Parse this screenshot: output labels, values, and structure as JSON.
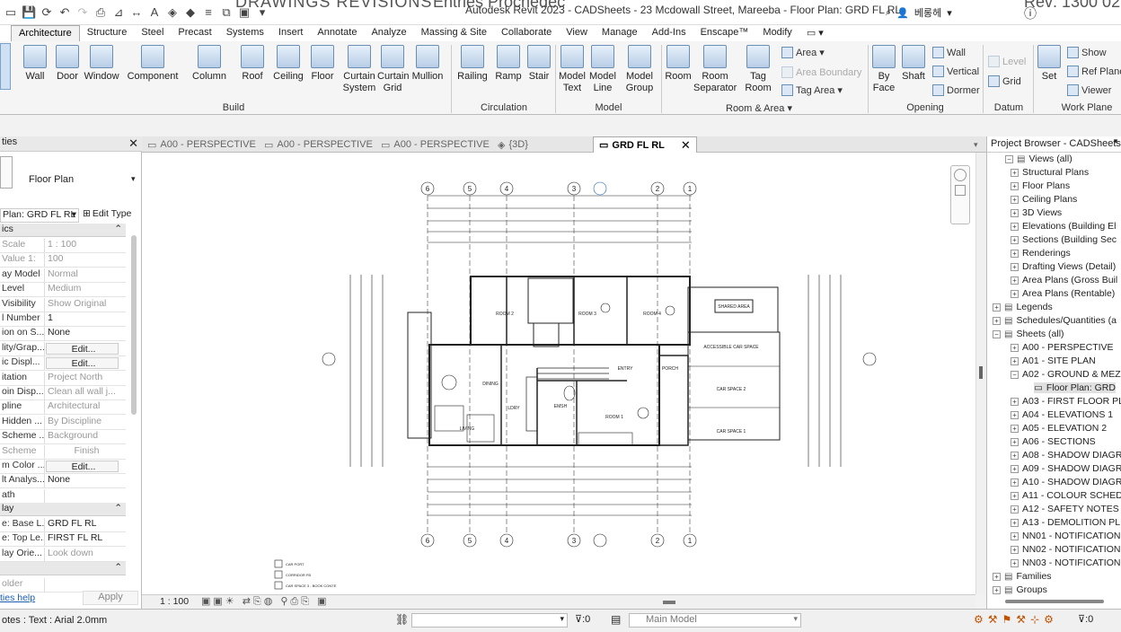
{
  "app": {
    "title": "Autodesk Revit 2023 - CADSheets - 23 Mcdowall Street, Mareeba - Floor Plan: GRD FL RL",
    "bg_left": "DRAWINGS      REVISIONS",
    "bg_mid": "Entries    Prochedec",
    "bg_right": "Rev: 1300 028 226",
    "user": "베롱헤"
  },
  "tabs": [
    "Architecture",
    "Structure",
    "Steel",
    "Precast",
    "Systems",
    "Insert",
    "Annotate",
    "Analyze",
    "Massing & Site",
    "Collaborate",
    "View",
    "Manage",
    "Add-Ins",
    "Enscape™",
    "Modify"
  ],
  "ribbon": {
    "build": {
      "label": "Build",
      "wall": "Wall",
      "door": "Door",
      "window": "Window",
      "component": "Component",
      "column": "Column",
      "roof": "Roof",
      "ceiling": "Ceiling",
      "floor": "Floor",
      "curtain_system": "Curtain\nSystem",
      "curtain_grid": "Curtain\nGrid",
      "mullion": "Mullion"
    },
    "circulation": {
      "label": "Circulation",
      "railing": "Railing",
      "ramp": "Ramp",
      "stair": "Stair"
    },
    "model": {
      "label": "Model",
      "model_text": "Model\nText",
      "model_line": "Model\nLine",
      "model_group": "Model\nGroup"
    },
    "room_area": {
      "label": "Room & Area",
      "room": "Room",
      "room_separator": "Room\nSeparator",
      "tag_room": "Tag\nRoom",
      "area": "Area",
      "area_boundary": "Area  Boundary",
      "tag_area": "Tag  Area"
    },
    "opening": {
      "label": "Opening",
      "by_face": "By\nFace",
      "shaft": "Shaft",
      "wall": "Wall",
      "vertical": "Vertical",
      "dormer": "Dormer"
    },
    "datum": {
      "label": "Datum",
      "level": "Level",
      "grid": "Grid"
    },
    "work_plane": {
      "label": "Work Plane",
      "set": "Set",
      "show": "Show",
      "ref_plane": "Ref  Plane",
      "viewer": "Viewer"
    }
  },
  "properties": {
    "title": "ties",
    "type": "Floor Plan",
    "instance": "Plan: GRD FL RL",
    "edit_type": "Edit Type",
    "section1": "ics",
    "section2": "lay",
    "help": "ties help",
    "apply": "Apply",
    "rows": [
      [
        "Scale",
        "1 : 100"
      ],
      [
        "Value  1:",
        "100"
      ],
      [
        "ay Model",
        "Normal"
      ],
      [
        "Level",
        "Medium"
      ],
      [
        "Visibility",
        "Show Original"
      ],
      [
        "l Number",
        "1"
      ],
      [
        "ion on S...",
        "None"
      ],
      [
        "lity/Grap...",
        "Edit..."
      ],
      [
        "ic Displ...",
        "Edit..."
      ],
      [
        "itation",
        "Project North"
      ],
      [
        "oin Disp...",
        "Clean all wall j..."
      ],
      [
        "pline",
        "Architectural"
      ],
      [
        "Hidden ...",
        "By Discipline"
      ],
      [
        "Scheme ...",
        "Background"
      ],
      [
        "Scheme",
        "Finish"
      ],
      [
        "m Color ...",
        "Edit..."
      ],
      [
        "lt Analys...",
        "None"
      ],
      [
        "ath",
        ""
      ]
    ],
    "rows2": [
      [
        "e: Base L...",
        "GRD FL RL"
      ],
      [
        "e: Top Le...",
        "FIRST FL RL"
      ],
      [
        "lay Orie...",
        "Look down"
      ]
    ],
    "holder": "older"
  },
  "view_tabs": [
    "A00 - PERSPECTIVE",
    "A00 - PERSPECTIVE",
    "A00 - PERSPECTIVE",
    "{3D}",
    "GRD FL RL"
  ],
  "plan": {
    "grids_top": [
      "6",
      "5",
      "4",
      "3",
      "2",
      "1"
    ],
    "rooms": [
      "ROOM 2",
      "ROOM 3",
      "ROOM 4",
      "DINING",
      "LDRY",
      "EMSH",
      "ENTRY",
      "PORCH",
      "ROOM 1",
      "LIVING",
      "ACCESSIBLE CAR SPACE",
      "CAR SPACE 2",
      "CAR SPACE 1",
      "SHARED AREA"
    ],
    "legend": [
      "CAR PORT",
      "CORRIDOR FB",
      "CAR SPACE 3 - BOOK CONTE"
    ]
  },
  "view_control": {
    "scale": "1 : 100"
  },
  "browser": {
    "title": "Project Browser - CADSheets -",
    "items": [
      {
        "t": "Views (all)",
        "l": 1,
        "e": "−"
      },
      {
        "t": "Structural Plans",
        "l": 2,
        "e": "+"
      },
      {
        "t": "Floor Plans",
        "l": 2,
        "e": "+"
      },
      {
        "t": "Ceiling Plans",
        "l": 2,
        "e": "+"
      },
      {
        "t": "3D Views",
        "l": 2,
        "e": "+"
      },
      {
        "t": "Elevations (Building El",
        "l": 2,
        "e": "+"
      },
      {
        "t": "Sections (Building Sec",
        "l": 2,
        "e": "+"
      },
      {
        "t": "Renderings",
        "l": 2,
        "e": "+"
      },
      {
        "t": "Drafting Views (Detail)",
        "l": 2,
        "e": "+"
      },
      {
        "t": "Area Plans (Gross Buil",
        "l": 2,
        "e": "+"
      },
      {
        "t": "Area Plans (Rentable)",
        "l": 2,
        "e": "+"
      },
      {
        "t": "Legends",
        "l": 0,
        "e": "+"
      },
      {
        "t": "Schedules/Quantities (a",
        "l": 0,
        "e": "+"
      },
      {
        "t": "Sheets (all)",
        "l": 0,
        "e": "−"
      },
      {
        "t": "A00 - PERSPECTIVE",
        "l": 2,
        "e": "+"
      },
      {
        "t": "A01 - SITE PLAN",
        "l": 2,
        "e": "+"
      },
      {
        "t": "A02 - GROUND & MEZ",
        "l": 2,
        "e": "−"
      },
      {
        "t": "Floor Plan: GRD",
        "l": 3,
        "e": ""
      },
      {
        "t": "A03 - FIRST FLOOR PLA",
        "l": 2,
        "e": "+"
      },
      {
        "t": "A04 - ELEVATIONS 1",
        "l": 2,
        "e": "+"
      },
      {
        "t": "A05 - ELEVATION 2",
        "l": 2,
        "e": "+"
      },
      {
        "t": "A06 - SECTIONS",
        "l": 2,
        "e": "+"
      },
      {
        "t": "A08 - SHADOW DIAGR",
        "l": 2,
        "e": "+"
      },
      {
        "t": "A09 - SHADOW DIAGR",
        "l": 2,
        "e": "+"
      },
      {
        "t": "A10 - SHADOW DIAGR",
        "l": 2,
        "e": "+"
      },
      {
        "t": "A11 - COLOUR SCHED",
        "l": 2,
        "e": "+"
      },
      {
        "t": "A12 - SAFETY NOTES",
        "l": 2,
        "e": "+"
      },
      {
        "t": "A13 - DEMOLITION PL",
        "l": 2,
        "e": "+"
      },
      {
        "t": "NN01 - NOTIFICATION",
        "l": 2,
        "e": "+"
      },
      {
        "t": "NN02 - NOTIFICATION",
        "l": 2,
        "e": "+"
      },
      {
        "t": "NN03 - NOTIFICATION",
        "l": 2,
        "e": "+"
      },
      {
        "t": "Families",
        "l": 0,
        "e": "+"
      },
      {
        "t": "Groups",
        "l": 0,
        "e": "+"
      }
    ]
  },
  "status": {
    "left": "otes : Text : Arial 2.0mm",
    "sel_count": ":0",
    "workset": "Main Model",
    "filter_count": ":0"
  }
}
